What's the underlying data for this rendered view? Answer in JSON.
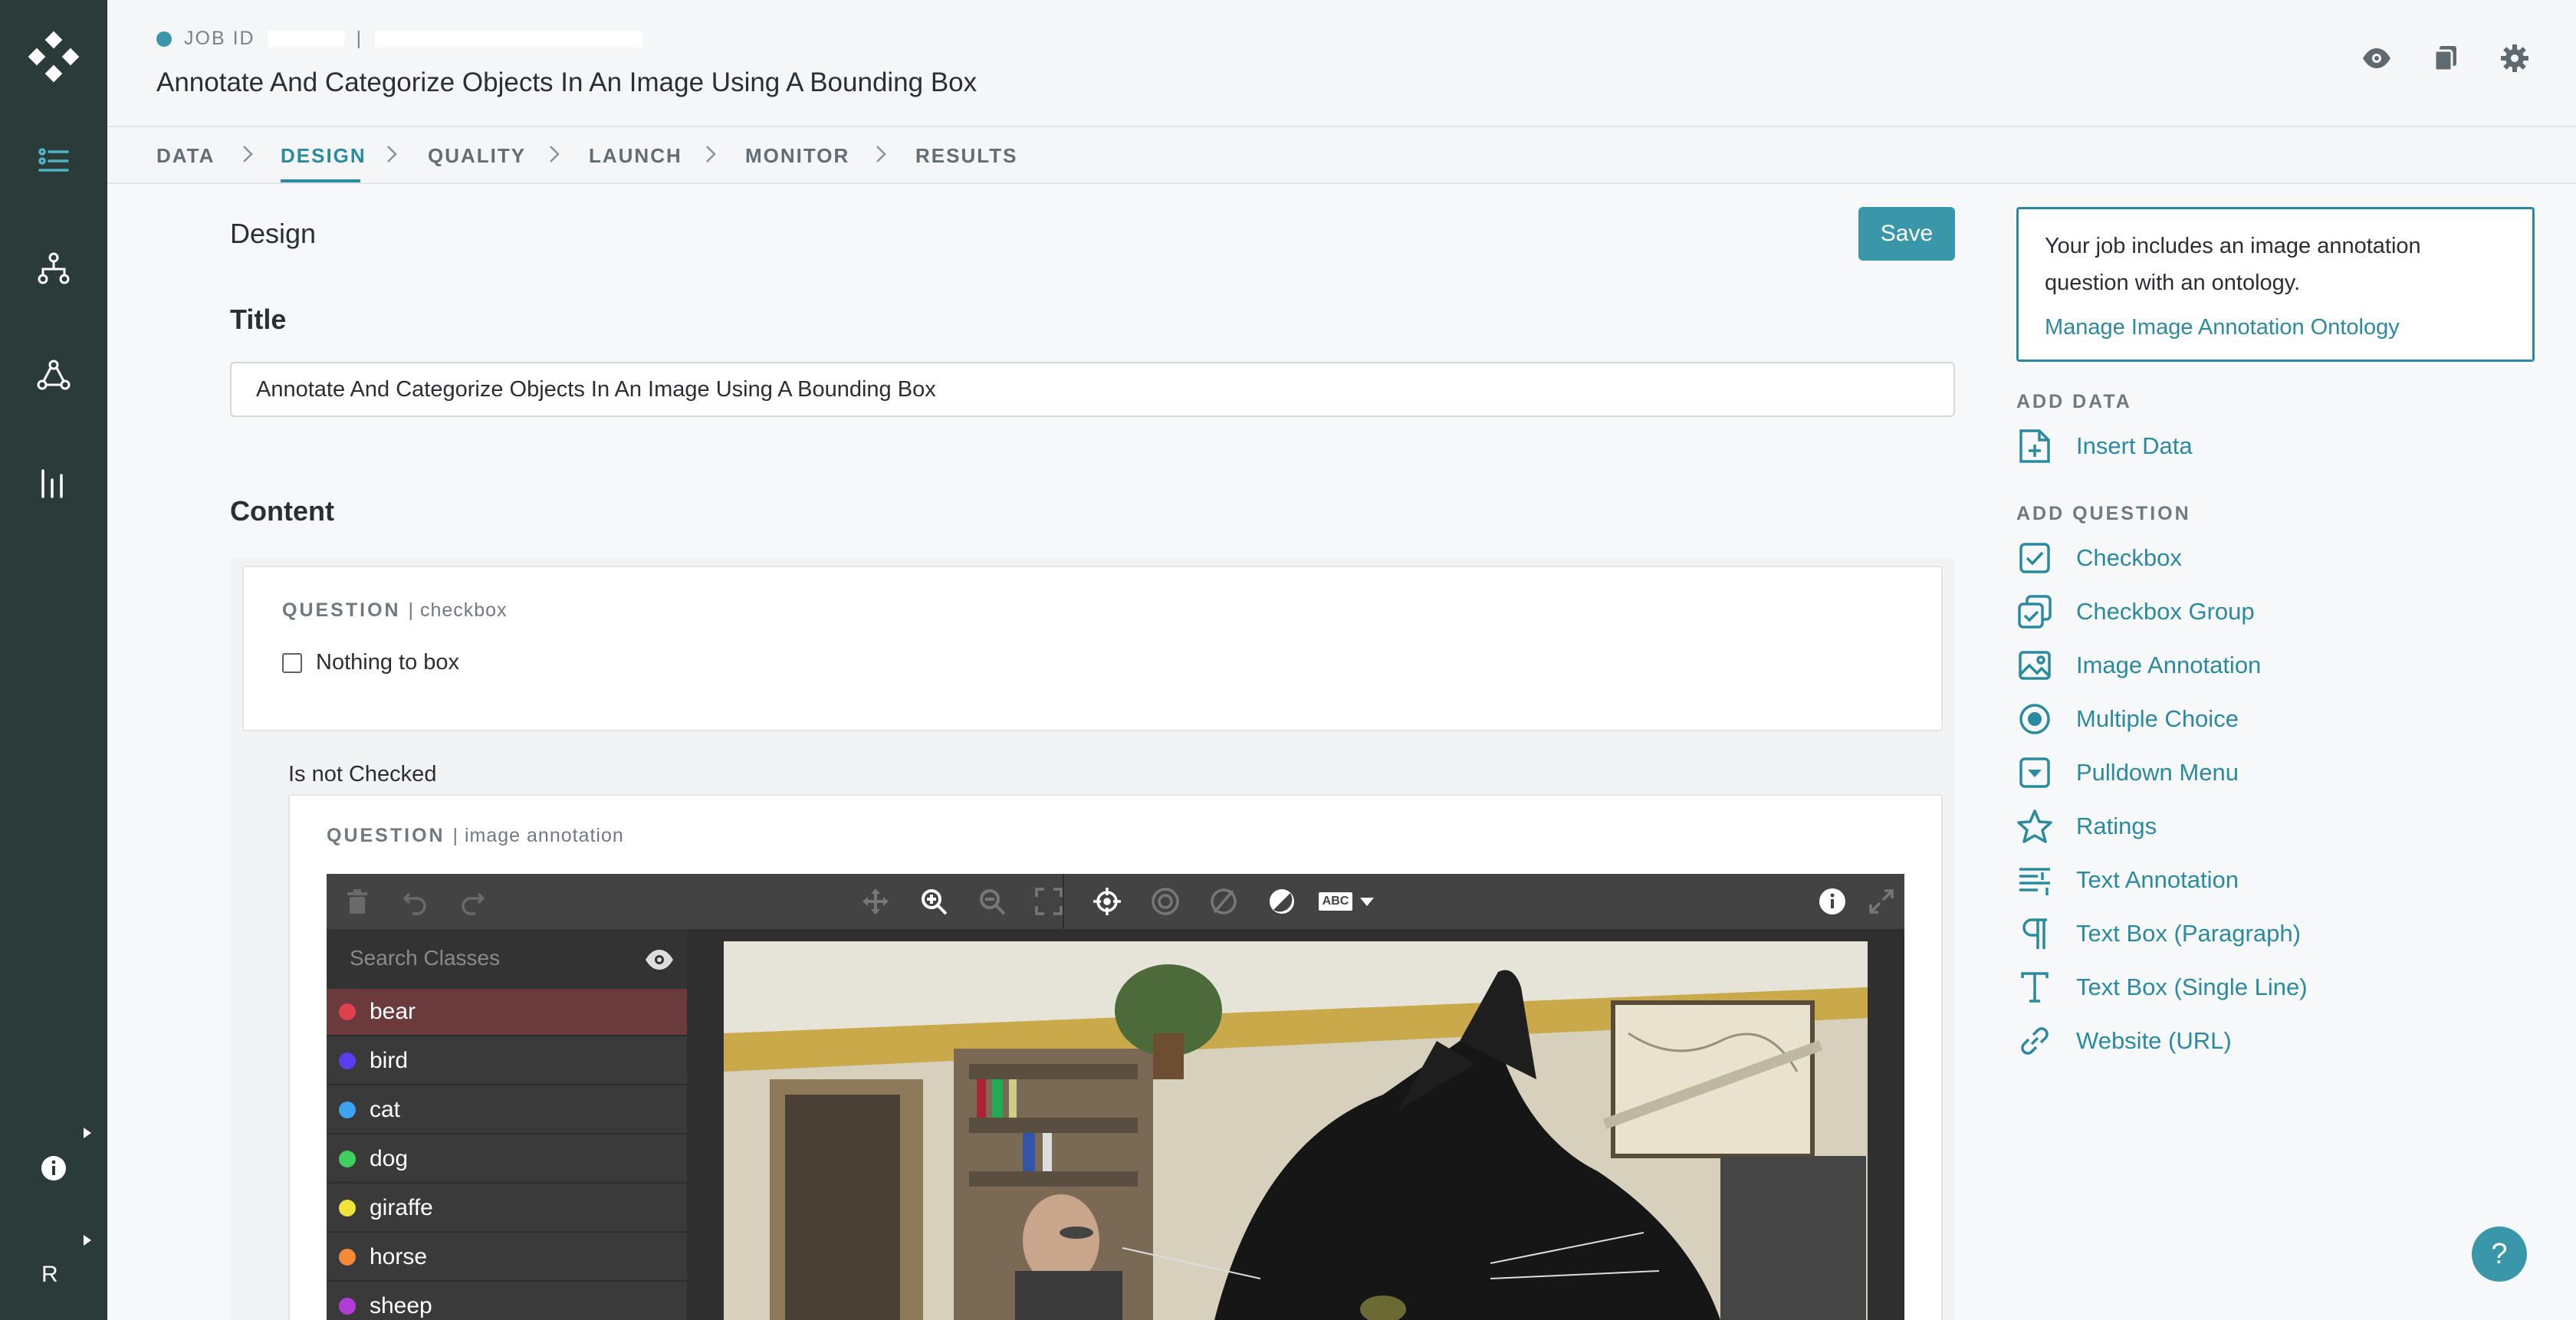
{
  "header": {
    "job_id_label": "JOB ID",
    "job_id_sep": "|",
    "title": "Annotate And Categorize Objects In An Image Using A Bounding Box",
    "icons": [
      "eye-icon",
      "copy-icon",
      "gear-icon"
    ]
  },
  "rail": {
    "avatar_letter": "R",
    "icons": [
      "logo-icon",
      "job-list-icon",
      "workflow-icon",
      "network-icon",
      "bar-chart-icon",
      "info-icon"
    ]
  },
  "tabs": [
    "DATA",
    "DESIGN",
    "QUALITY",
    "LAUNCH",
    "MONITOR",
    "RESULTS"
  ],
  "active_tab": "DESIGN",
  "main": {
    "heading": "Design",
    "save_label": "Save",
    "title_label": "Title",
    "title_value": "Annotate And Categorize Objects In An Image Using A Bounding Box",
    "content_label": "Content",
    "q1": {
      "label": "QUESTION",
      "type": "| checkbox",
      "option": "Nothing to box"
    },
    "condition": "Is not Checked",
    "q2": {
      "label": "QUESTION",
      "type": "| image annotation"
    }
  },
  "annotation_tool": {
    "search_placeholder": "Search Classes",
    "label_icon_text": "ABC",
    "classes": [
      {
        "name": "bear",
        "color": "#e0404c",
        "selected": true
      },
      {
        "name": "bird",
        "color": "#5b3cf0",
        "selected": false
      },
      {
        "name": "cat",
        "color": "#3aa3f2",
        "selected": false
      },
      {
        "name": "dog",
        "color": "#3fcf5a",
        "selected": false
      },
      {
        "name": "giraffe",
        "color": "#f2e23a",
        "selected": false
      },
      {
        "name": "horse",
        "color": "#f28a3a",
        "selected": false
      },
      {
        "name": "sheep",
        "color": "#b13cd8",
        "selected": false
      }
    ]
  },
  "right_panel": {
    "info_text": "Your job includes an image annotation question with an ontology.",
    "info_link": "Manage Image Annotation Ontology",
    "add_data_heading": "ADD DATA",
    "insert_data": "Insert Data",
    "add_question_heading": "ADD QUESTION",
    "questions": [
      "Checkbox",
      "Checkbox Group",
      "Image Annotation",
      "Multiple Choice",
      "Pulldown Menu",
      "Ratings",
      "Text Annotation",
      "Text Box (Paragraph)",
      "Text Box (Single Line)",
      "Website (URL)"
    ]
  },
  "help_label": "?",
  "colors": {
    "accent": "#2a8aa0",
    "rail": "#2b3b3a",
    "save": "#3a97aa"
  }
}
